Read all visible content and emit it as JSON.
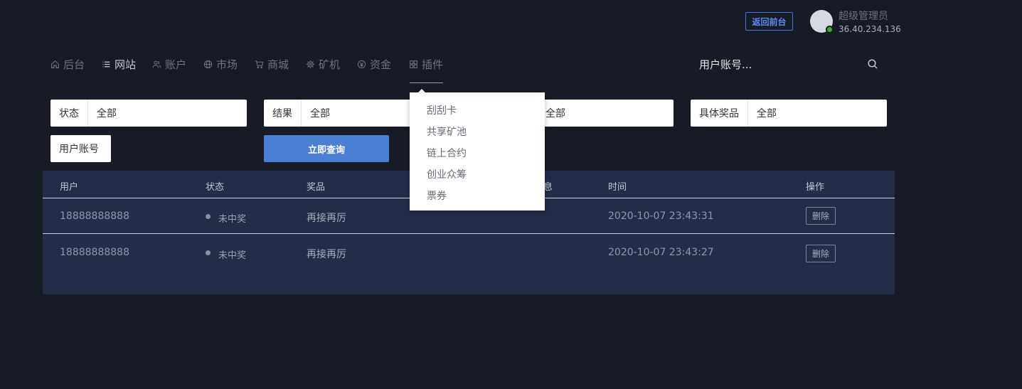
{
  "header": {
    "back_button": "返回前台",
    "user_name": "超级管理员",
    "user_ip": "36.40.234.136"
  },
  "nav": {
    "items": [
      {
        "label": "后台",
        "icon": "home-icon"
      },
      {
        "label": "网站",
        "icon": "list-icon"
      },
      {
        "label": "账户",
        "icon": "users-icon"
      },
      {
        "label": "市场",
        "icon": "globe-icon"
      },
      {
        "label": "商城",
        "icon": "cart-icon"
      },
      {
        "label": "矿机",
        "icon": "chip-icon"
      },
      {
        "label": "资金",
        "icon": "coin-icon"
      },
      {
        "label": "插件",
        "icon": "grid-icon"
      }
    ],
    "active": "网站",
    "search_label": "用户账号..."
  },
  "filters": {
    "status": {
      "label": "状态",
      "value": "全部"
    },
    "result": {
      "label": "结果",
      "value": "全部"
    },
    "third": {
      "value": "全部"
    },
    "prize": {
      "label": "具体奖品",
      "value": "全部"
    },
    "account": {
      "label": "用户账号"
    },
    "query_button": "立即查询"
  },
  "table": {
    "headers": {
      "user": "用户",
      "status": "状态",
      "prize": "奖品",
      "partial": "息",
      "time": "时间",
      "action": "操作"
    },
    "rows": [
      {
        "user": "18888888888",
        "status": "未中奖",
        "prize": "再接再厉",
        "time": "2020-10-07 23:43:31",
        "action": "删除"
      },
      {
        "user": "18888888888",
        "status": "未中奖",
        "prize": "再接再厉",
        "time": "2020-10-07 23:43:27",
        "action": "删除"
      }
    ]
  },
  "dropdown": {
    "items": [
      "刮刮卡",
      "共享矿池",
      "链上合约",
      "创业众筹",
      "票券"
    ]
  },
  "colors": {
    "background": "#171b26",
    "panel": "#232d47",
    "accent": "#4a80d4",
    "online": "#3fae2a"
  }
}
